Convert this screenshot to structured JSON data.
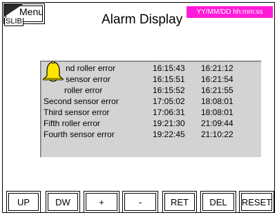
{
  "header": {
    "menu_label": "Menu",
    "slib_label": "SLIB",
    "title": "Alarm Display",
    "datetime_format": "YY/MM/DD  hh:mm:ss",
    "datetime_bg": "#ff1ad9"
  },
  "alarm_icon": "bell-icon",
  "alarms": [
    {
      "name": "Second roller error",
      "visible_name": "nd roller error",
      "t1": "16:15:43",
      "t2": "16:21:12"
    },
    {
      "name": "First sensor error",
      "visible_name": "sensor error",
      "t1": "16:15:51",
      "t2": "16:21:54"
    },
    {
      "name": "First roller error",
      "visible_name": "roller error",
      "t1": "16:15:52",
      "t2": "16:21:55"
    },
    {
      "name": "Second sensor error",
      "visible_name": "Second sensor error",
      "t1": "17:05:02",
      "t2": "18:08:01"
    },
    {
      "name": "Third sensor error",
      "visible_name": "Third sensor error",
      "t1": "17:06:31",
      "t2": "18:08:01"
    },
    {
      "name": "Fifth roller error",
      "visible_name": "Fifth roller error",
      "t1": "19:21:30",
      "t2": "21:09:44"
    },
    {
      "name": "Fourth sensor error",
      "visible_name": "Fourth sensor error",
      "t1": "19:22:45",
      "t2": "21:10:22"
    }
  ],
  "buttons": {
    "up": "UP",
    "dw": "DW",
    "plus": "+",
    "minus": "-",
    "ret": "RET",
    "del": "DEL",
    "reset": "RESET"
  }
}
